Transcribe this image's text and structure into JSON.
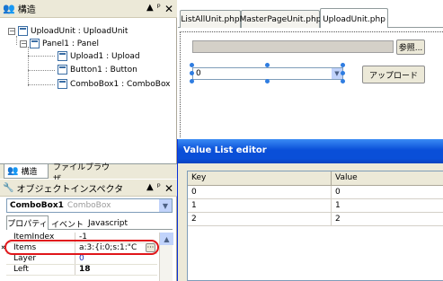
{
  "structure_panel": {
    "title": "構造",
    "tree": [
      {
        "label": "UploadUnit : UploadUnit"
      },
      {
        "label": "Panel1 : Panel"
      },
      {
        "label": "Upload1 : Upload"
      },
      {
        "label": "Button1 : Button"
      },
      {
        "label": "ComboBox1 : ComboBox"
      }
    ],
    "bottom_tabs": [
      "構造",
      "ファイルブラウザ"
    ]
  },
  "inspector": {
    "title": "オブジェクトインスペクタ",
    "component_name": "ComboBox1",
    "component_type": "ComboBox",
    "tabs": [
      "プロパティ",
      "イベント",
      "Javascript"
    ],
    "properties": [
      {
        "name": "ItemIndex",
        "value": "-1"
      },
      {
        "name": "Items",
        "value": "a:3:{i:0;s:1:\"C"
      },
      {
        "name": "Layer",
        "value": "0"
      },
      {
        "name": "Left",
        "value": "18"
      }
    ],
    "highlight_color": "#e0161a"
  },
  "editor": {
    "tabs": [
      "ListAllUnit.php",
      "MasterPageUnit.php",
      "UploadUnit.php"
    ],
    "browse_button": "参照...",
    "combo_value": "0",
    "upload_button": "アップロード"
  },
  "value_list_editor": {
    "title": "Value List editor",
    "columns": [
      "Key",
      "Value"
    ],
    "rows": [
      {
        "key": "0",
        "value": "0"
      },
      {
        "key": "1",
        "value": "1"
      },
      {
        "key": "2",
        "value": "2"
      }
    ]
  },
  "colors": {
    "dialog_title": "#0a4fd8",
    "chrome": "#ece9d8"
  }
}
